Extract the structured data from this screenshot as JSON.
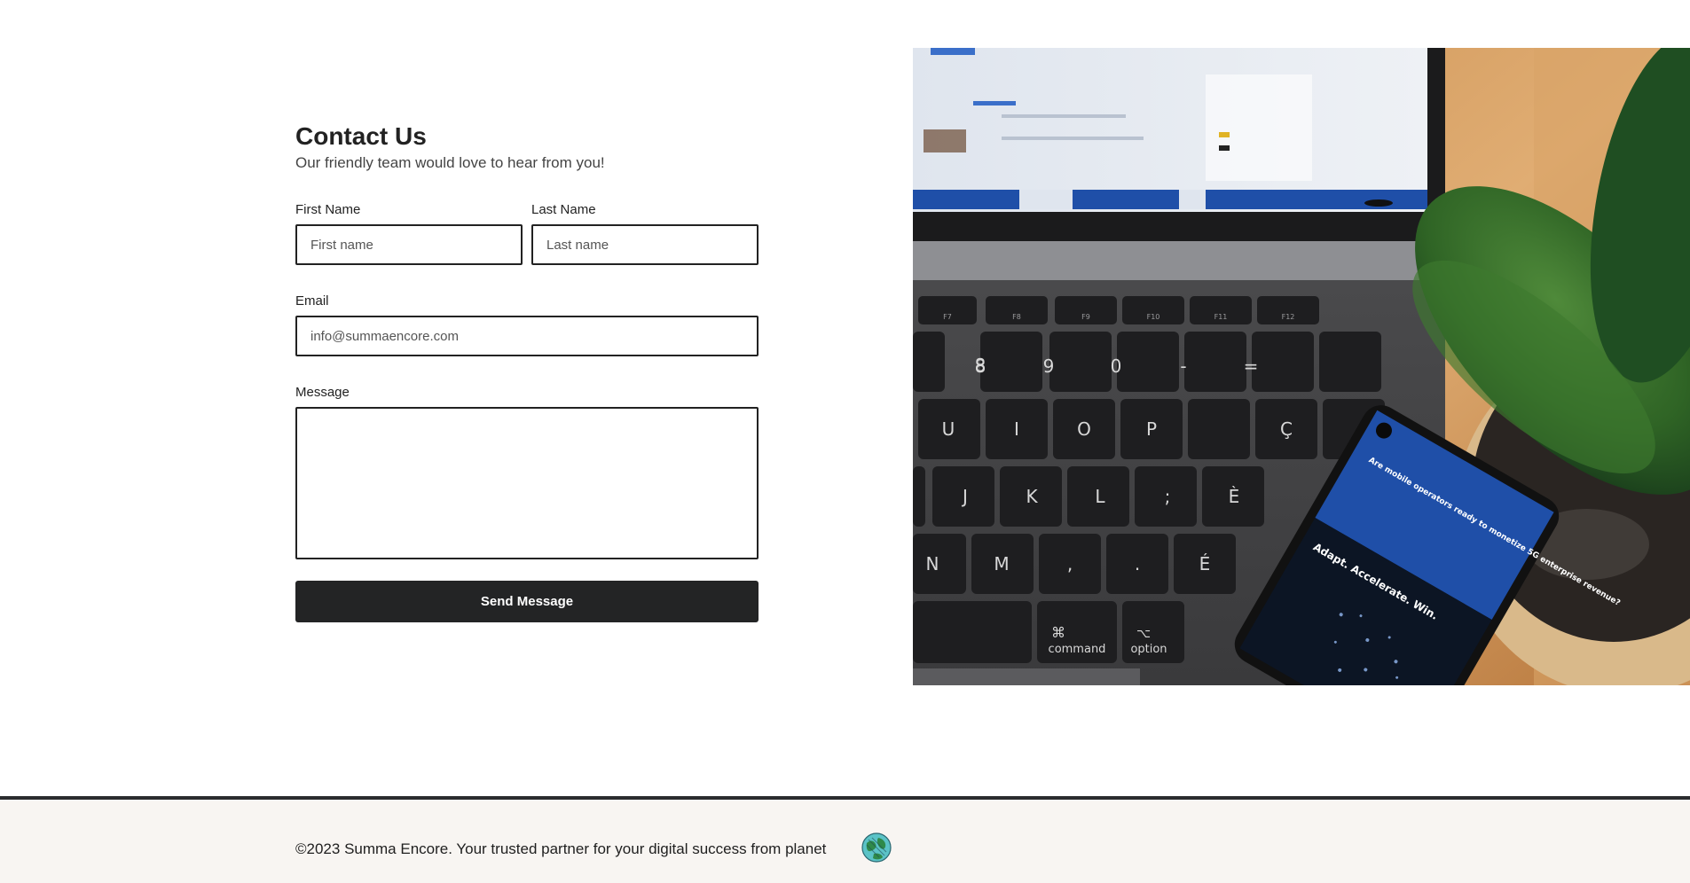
{
  "contact": {
    "title": "Contact Us",
    "subtitle": "Our friendly team would love to hear from you!"
  },
  "form": {
    "first_name": {
      "label": "First Name",
      "placeholder": "First name",
      "value": ""
    },
    "last_name": {
      "label": "Last Name",
      "placeholder": "Last name",
      "value": ""
    },
    "email": {
      "label": "Email",
      "placeholder": "info@summaencore.com",
      "value": ""
    },
    "message": {
      "label": "Message",
      "value": ""
    },
    "submit_label": "Send Message"
  },
  "photo": {
    "keys_row1": [
      "F7",
      "F8",
      "F9",
      "F10",
      "F11",
      "F12"
    ],
    "keys_row2": [
      "8",
      "9",
      "0",
      "-",
      "="
    ],
    "keys_row3": [
      "U",
      "I",
      "O",
      "P",
      "Ç"
    ],
    "keys_row4": [
      "J",
      "K",
      "L",
      ";",
      "È"
    ],
    "keys_row5": [
      "N",
      "M",
      ",",
      ".",
      "É"
    ],
    "key_command": "command",
    "key_option": "option",
    "phone_headline": "Are mobile operators ready to monetize 5G enterprise revenue?",
    "phone_tagline": "Adapt. Accelerate. Win."
  },
  "footer": {
    "text": "©2023 Summa Encore. Your trusted partner for your digital success from planet"
  },
  "colors": {
    "button_bg": "#232425",
    "footer_bg": "#f8f5f2",
    "footer_border": "#2b2c2e",
    "accent_blue": "#1f4fa8"
  },
  "icons": {
    "planet": "planet-earth-icon"
  }
}
